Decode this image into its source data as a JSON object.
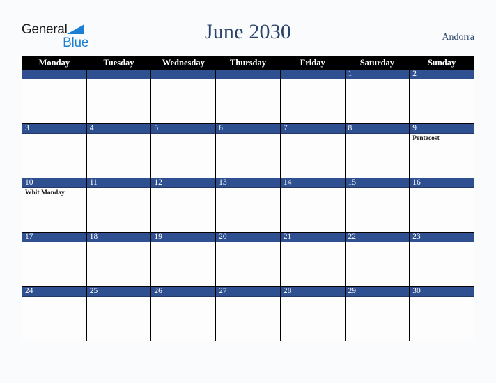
{
  "brand": {
    "name_part1": "General",
    "name_part2": "Blue",
    "triangle_color": "#1b7fd4"
  },
  "header": {
    "title": "June 2030",
    "country": "Andorra"
  },
  "theme": {
    "accent_blue": "#2e5090",
    "header_black": "#000000",
    "title_navy": "#2b4469",
    "page_background": "#fafbfc"
  },
  "calendar": {
    "month": "June",
    "year": "2030",
    "weekday_headers": [
      "Monday",
      "Tuesday",
      "Wednesday",
      "Thursday",
      "Friday",
      "Saturday",
      "Sunday"
    ],
    "weeks": [
      [
        {
          "day": "",
          "holiday": ""
        },
        {
          "day": "",
          "holiday": ""
        },
        {
          "day": "",
          "holiday": ""
        },
        {
          "day": "",
          "holiday": ""
        },
        {
          "day": "",
          "holiday": ""
        },
        {
          "day": "1",
          "holiday": ""
        },
        {
          "day": "2",
          "holiday": ""
        }
      ],
      [
        {
          "day": "3",
          "holiday": ""
        },
        {
          "day": "4",
          "holiday": ""
        },
        {
          "day": "5",
          "holiday": ""
        },
        {
          "day": "6",
          "holiday": ""
        },
        {
          "day": "7",
          "holiday": ""
        },
        {
          "day": "8",
          "holiday": ""
        },
        {
          "day": "9",
          "holiday": "Pentecost"
        }
      ],
      [
        {
          "day": "10",
          "holiday": "Whit Monday"
        },
        {
          "day": "11",
          "holiday": ""
        },
        {
          "day": "12",
          "holiday": ""
        },
        {
          "day": "13",
          "holiday": ""
        },
        {
          "day": "14",
          "holiday": ""
        },
        {
          "day": "15",
          "holiday": ""
        },
        {
          "day": "16",
          "holiday": ""
        }
      ],
      [
        {
          "day": "17",
          "holiday": ""
        },
        {
          "day": "18",
          "holiday": ""
        },
        {
          "day": "19",
          "holiday": ""
        },
        {
          "day": "20",
          "holiday": ""
        },
        {
          "day": "21",
          "holiday": ""
        },
        {
          "day": "22",
          "holiday": ""
        },
        {
          "day": "23",
          "holiday": ""
        }
      ],
      [
        {
          "day": "24",
          "holiday": ""
        },
        {
          "day": "25",
          "holiday": ""
        },
        {
          "day": "26",
          "holiday": ""
        },
        {
          "day": "27",
          "holiday": ""
        },
        {
          "day": "28",
          "holiday": ""
        },
        {
          "day": "29",
          "holiday": ""
        },
        {
          "day": "30",
          "holiday": ""
        }
      ]
    ]
  }
}
